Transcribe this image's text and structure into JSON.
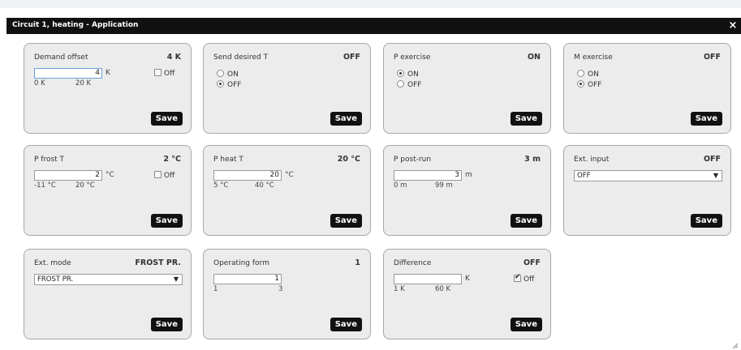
{
  "dialog": {
    "title": "Circuit 1, heating - Application",
    "close_icon": "×"
  },
  "save_label": "Save",
  "off_label": "Off",
  "cards": {
    "demand_offset": {
      "title": "Demand offset",
      "value": "4 K",
      "input": "4",
      "unit": "K",
      "min": "0 K",
      "max": "20 K",
      "off_checked": false
    },
    "send_desired_t": {
      "title": "Send desired T",
      "value": "OFF",
      "options": [
        "ON",
        "OFF"
      ],
      "selected": "OFF"
    },
    "p_exercise": {
      "title": "P exercise",
      "value": "ON",
      "options": [
        "ON",
        "OFF"
      ],
      "selected": "ON"
    },
    "m_exercise": {
      "title": "M exercise",
      "value": "OFF",
      "options": [
        "ON",
        "OFF"
      ],
      "selected": "OFF"
    },
    "p_frost_t": {
      "title": "P frost T",
      "value": "2 °C",
      "input": "2",
      "unit": "°C",
      "min": "-11 °C",
      "max": "20 °C",
      "off_checked": false
    },
    "p_heat_t": {
      "title": "P heat T",
      "value": "20 °C",
      "input": "20",
      "unit": "°C",
      "min": "5 °C",
      "max": "40 °C"
    },
    "p_post_run": {
      "title": "P post-run",
      "value": "3 m",
      "input": "3",
      "unit": "m",
      "min": "0 m",
      "max": "99 m"
    },
    "ext_input": {
      "title": "Ext. input",
      "value": "OFF",
      "select": "OFF"
    },
    "ext_mode": {
      "title": "Ext. mode",
      "value": "FROST PR.",
      "select": "FROST PR."
    },
    "operating_form": {
      "title": "Operating form",
      "value": "1",
      "input": "1",
      "min": "1",
      "max": "3"
    },
    "difference": {
      "title": "Difference",
      "value": "OFF",
      "input": "",
      "unit": "K",
      "min": "1 K",
      "max": "60 K",
      "off_checked": true
    }
  }
}
